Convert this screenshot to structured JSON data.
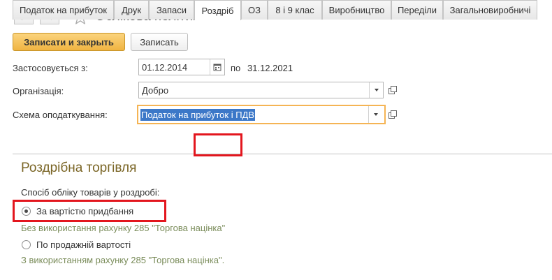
{
  "header": {
    "title": "Облікова політика",
    "icons": {
      "back": "arrow-left-icon",
      "forward": "arrow-right-icon",
      "favorite": "star-icon"
    }
  },
  "toolbar": {
    "save_close_label": "Записати и закрыть",
    "save_label": "Записать"
  },
  "form": {
    "applies_label": "Застосовується з:",
    "date_from": "01.12.2014",
    "to_label": "по",
    "date_to": "31.12.2021",
    "organization_label": "Організація:",
    "organization_value": "Добро",
    "tax_scheme_label": "Схема оподаткування:",
    "tax_scheme_value": "Податок на прибуток і ПДВ"
  },
  "tabs": [
    {
      "label": "Податок на прибуток"
    },
    {
      "label": "Друк"
    },
    {
      "label": "Запаси"
    },
    {
      "label": "Роздріб"
    },
    {
      "label": "ОЗ"
    },
    {
      "label": "8 і 9 клас"
    },
    {
      "label": "Виробництво"
    },
    {
      "label": "Переділи"
    },
    {
      "label": "Загальновиробничі"
    }
  ],
  "active_tab": "Роздріб",
  "retail": {
    "section_title": "Роздрібна торгівля",
    "method_label": "Спосіб обліку товарів у роздробі:",
    "options": [
      {
        "label": "За вартістю придбання",
        "hint": "Без використання рахунку 285 \"Торгова націнка\"",
        "selected": true
      },
      {
        "label": "По продажній вартості",
        "hint": "З використанням рахунку 285 \"Торгова націнка\".",
        "selected": false
      }
    ]
  },
  "colors": {
    "primary_button": "#f0b441",
    "highlight_box": "#e3161e",
    "section_title": "#7a6525",
    "hint_text": "#7a8c5a",
    "focus_border": "#f5b454",
    "selection": "#3c78c8"
  }
}
